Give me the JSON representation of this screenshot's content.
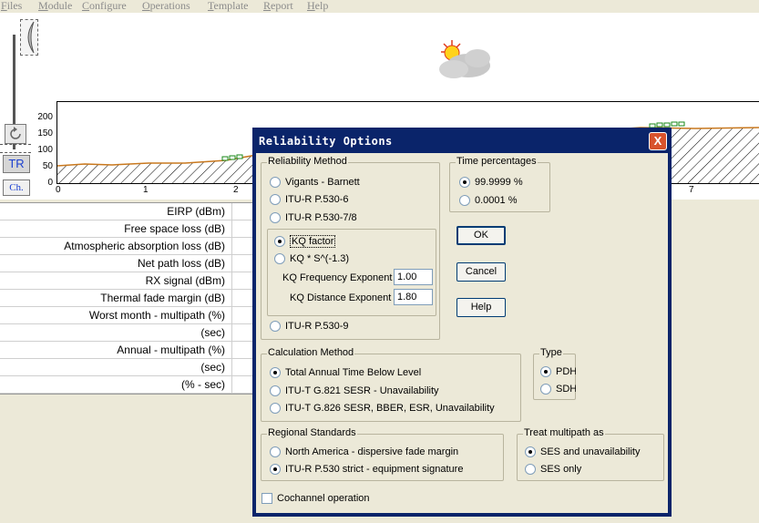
{
  "menu": [
    "Files",
    "Module",
    "Configure",
    "Operations",
    "Template",
    "Report",
    "Help"
  ],
  "toolbar": {
    "tr_label": "TR",
    "ch_label": "Ch."
  },
  "chart_data": {
    "type": "area",
    "y_ticks": [
      "200",
      "150",
      "100",
      "50",
      "0"
    ],
    "x_ticks": [
      "0",
      "1",
      "2",
      "7"
    ],
    "ylim": [
      0,
      200
    ],
    "grid": false
  },
  "results_table": {
    "rows": [
      "EIRP (dBm)",
      "Free space loss (dB)",
      "Atmospheric absorption loss (dB)",
      "Net path loss (dB)",
      "RX signal (dBm)",
      "Thermal fade margin (dB)",
      "Worst month - multipath (%)",
      "(sec)",
      "Annual - multipath (%)",
      "(sec)",
      "(% - sec)"
    ]
  },
  "dialog": {
    "title": "Reliability Options",
    "close_label": "X",
    "reliability": {
      "legend": "Reliability Method",
      "vigants": "Vigants - Barnett",
      "p530_6": "ITU-R P.530-6",
      "p530_7": "ITU-R P.530-7/8",
      "kq_factor": "KQ factor",
      "kq_s": "KQ * S^(-1.3)",
      "freq_exp_label": "KQ Frequency Exponent",
      "freq_exp_value": "1.00",
      "dist_exp_label": "KQ Distance Exponent",
      "dist_exp_value": "1.80",
      "p530_9": "ITU-R P.530-9"
    },
    "time": {
      "legend": "Time percentages",
      "opt1": "99.9999 %",
      "opt2": "0.0001 %"
    },
    "buttons": {
      "ok": "OK",
      "cancel": "Cancel",
      "help": "Help"
    },
    "calc": {
      "legend": "Calculation Method",
      "opt1": "Total Annual Time Below Level",
      "opt2": "ITU-T G.821 SESR - Unavailability",
      "opt3": "ITU-T G.826 SESR, BBER, ESR, Unavailability"
    },
    "type": {
      "legend": "Type",
      "opt1": "PDH",
      "opt2": "SDH"
    },
    "regional": {
      "legend": "Regional Standards",
      "opt1": "North America - dispersive fade margin",
      "opt2": "ITU-R P.530 strict - equipment signature"
    },
    "multipath": {
      "legend": "Treat multipath as",
      "opt1": "SES and unavailability",
      "opt2": "SES only"
    },
    "cochannel": "Cochannel operation"
  }
}
